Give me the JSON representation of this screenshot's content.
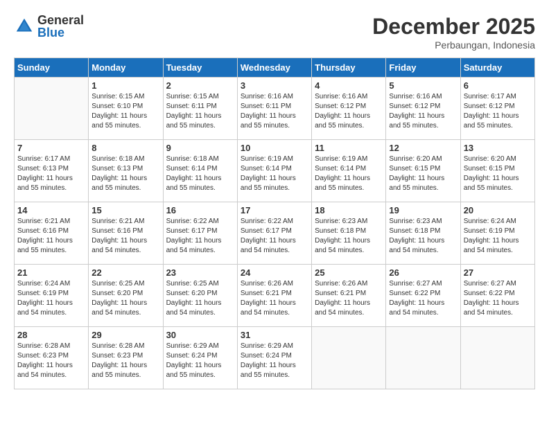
{
  "logo": {
    "general": "General",
    "blue": "Blue"
  },
  "title": {
    "month_year": "December 2025",
    "location": "Perbaungan, Indonesia"
  },
  "days_of_week": [
    "Sunday",
    "Monday",
    "Tuesday",
    "Wednesday",
    "Thursday",
    "Friday",
    "Saturday"
  ],
  "weeks": [
    [
      {
        "day": "",
        "sunrise": "",
        "sunset": "",
        "daylight": ""
      },
      {
        "day": "1",
        "sunrise": "Sunrise: 6:15 AM",
        "sunset": "Sunset: 6:10 PM",
        "daylight": "Daylight: 11 hours and 55 minutes."
      },
      {
        "day": "2",
        "sunrise": "Sunrise: 6:15 AM",
        "sunset": "Sunset: 6:11 PM",
        "daylight": "Daylight: 11 hours and 55 minutes."
      },
      {
        "day": "3",
        "sunrise": "Sunrise: 6:16 AM",
        "sunset": "Sunset: 6:11 PM",
        "daylight": "Daylight: 11 hours and 55 minutes."
      },
      {
        "day": "4",
        "sunrise": "Sunrise: 6:16 AM",
        "sunset": "Sunset: 6:12 PM",
        "daylight": "Daylight: 11 hours and 55 minutes."
      },
      {
        "day": "5",
        "sunrise": "Sunrise: 6:16 AM",
        "sunset": "Sunset: 6:12 PM",
        "daylight": "Daylight: 11 hours and 55 minutes."
      },
      {
        "day": "6",
        "sunrise": "Sunrise: 6:17 AM",
        "sunset": "Sunset: 6:12 PM",
        "daylight": "Daylight: 11 hours and 55 minutes."
      }
    ],
    [
      {
        "day": "7",
        "sunrise": "Sunrise: 6:17 AM",
        "sunset": "Sunset: 6:13 PM",
        "daylight": "Daylight: 11 hours and 55 minutes."
      },
      {
        "day": "8",
        "sunrise": "Sunrise: 6:18 AM",
        "sunset": "Sunset: 6:13 PM",
        "daylight": "Daylight: 11 hours and 55 minutes."
      },
      {
        "day": "9",
        "sunrise": "Sunrise: 6:18 AM",
        "sunset": "Sunset: 6:14 PM",
        "daylight": "Daylight: 11 hours and 55 minutes."
      },
      {
        "day": "10",
        "sunrise": "Sunrise: 6:19 AM",
        "sunset": "Sunset: 6:14 PM",
        "daylight": "Daylight: 11 hours and 55 minutes."
      },
      {
        "day": "11",
        "sunrise": "Sunrise: 6:19 AM",
        "sunset": "Sunset: 6:14 PM",
        "daylight": "Daylight: 11 hours and 55 minutes."
      },
      {
        "day": "12",
        "sunrise": "Sunrise: 6:20 AM",
        "sunset": "Sunset: 6:15 PM",
        "daylight": "Daylight: 11 hours and 55 minutes."
      },
      {
        "day": "13",
        "sunrise": "Sunrise: 6:20 AM",
        "sunset": "Sunset: 6:15 PM",
        "daylight": "Daylight: 11 hours and 55 minutes."
      }
    ],
    [
      {
        "day": "14",
        "sunrise": "Sunrise: 6:21 AM",
        "sunset": "Sunset: 6:16 PM",
        "daylight": "Daylight: 11 hours and 55 minutes."
      },
      {
        "day": "15",
        "sunrise": "Sunrise: 6:21 AM",
        "sunset": "Sunset: 6:16 PM",
        "daylight": "Daylight: 11 hours and 54 minutes."
      },
      {
        "day": "16",
        "sunrise": "Sunrise: 6:22 AM",
        "sunset": "Sunset: 6:17 PM",
        "daylight": "Daylight: 11 hours and 54 minutes."
      },
      {
        "day": "17",
        "sunrise": "Sunrise: 6:22 AM",
        "sunset": "Sunset: 6:17 PM",
        "daylight": "Daylight: 11 hours and 54 minutes."
      },
      {
        "day": "18",
        "sunrise": "Sunrise: 6:23 AM",
        "sunset": "Sunset: 6:18 PM",
        "daylight": "Daylight: 11 hours and 54 minutes."
      },
      {
        "day": "19",
        "sunrise": "Sunrise: 6:23 AM",
        "sunset": "Sunset: 6:18 PM",
        "daylight": "Daylight: 11 hours and 54 minutes."
      },
      {
        "day": "20",
        "sunrise": "Sunrise: 6:24 AM",
        "sunset": "Sunset: 6:19 PM",
        "daylight": "Daylight: 11 hours and 54 minutes."
      }
    ],
    [
      {
        "day": "21",
        "sunrise": "Sunrise: 6:24 AM",
        "sunset": "Sunset: 6:19 PM",
        "daylight": "Daylight: 11 hours and 54 minutes."
      },
      {
        "day": "22",
        "sunrise": "Sunrise: 6:25 AM",
        "sunset": "Sunset: 6:20 PM",
        "daylight": "Daylight: 11 hours and 54 minutes."
      },
      {
        "day": "23",
        "sunrise": "Sunrise: 6:25 AM",
        "sunset": "Sunset: 6:20 PM",
        "daylight": "Daylight: 11 hours and 54 minutes."
      },
      {
        "day": "24",
        "sunrise": "Sunrise: 6:26 AM",
        "sunset": "Sunset: 6:21 PM",
        "daylight": "Daylight: 11 hours and 54 minutes."
      },
      {
        "day": "25",
        "sunrise": "Sunrise: 6:26 AM",
        "sunset": "Sunset: 6:21 PM",
        "daylight": "Daylight: 11 hours and 54 minutes."
      },
      {
        "day": "26",
        "sunrise": "Sunrise: 6:27 AM",
        "sunset": "Sunset: 6:22 PM",
        "daylight": "Daylight: 11 hours and 54 minutes."
      },
      {
        "day": "27",
        "sunrise": "Sunrise: 6:27 AM",
        "sunset": "Sunset: 6:22 PM",
        "daylight": "Daylight: 11 hours and 54 minutes."
      }
    ],
    [
      {
        "day": "28",
        "sunrise": "Sunrise: 6:28 AM",
        "sunset": "Sunset: 6:23 PM",
        "daylight": "Daylight: 11 hours and 54 minutes."
      },
      {
        "day": "29",
        "sunrise": "Sunrise: 6:28 AM",
        "sunset": "Sunset: 6:23 PM",
        "daylight": "Daylight: 11 hours and 55 minutes."
      },
      {
        "day": "30",
        "sunrise": "Sunrise: 6:29 AM",
        "sunset": "Sunset: 6:24 PM",
        "daylight": "Daylight: 11 hours and 55 minutes."
      },
      {
        "day": "31",
        "sunrise": "Sunrise: 6:29 AM",
        "sunset": "Sunset: 6:24 PM",
        "daylight": "Daylight: 11 hours and 55 minutes."
      },
      {
        "day": "",
        "sunrise": "",
        "sunset": "",
        "daylight": ""
      },
      {
        "day": "",
        "sunrise": "",
        "sunset": "",
        "daylight": ""
      },
      {
        "day": "",
        "sunrise": "",
        "sunset": "",
        "daylight": ""
      }
    ]
  ]
}
